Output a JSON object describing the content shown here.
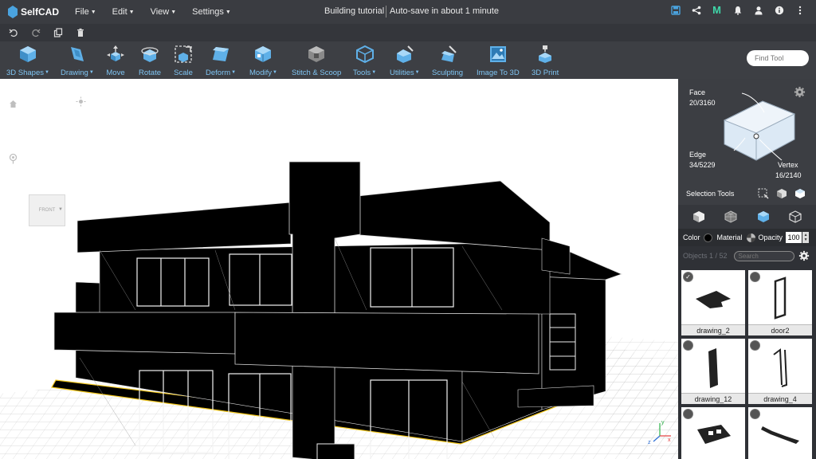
{
  "app": {
    "logo_text": "SelfCAD",
    "document_title": "Building tutorial",
    "autosave_status": "Auto-save in about 1 minute"
  },
  "menu": [
    {
      "label": "File"
    },
    {
      "label": "Edit"
    },
    {
      "label": "View"
    },
    {
      "label": "Settings"
    }
  ],
  "header_icons": [
    "save-icon",
    "share-icon",
    "m-logo-icon",
    "bell-icon",
    "user-icon",
    "info-icon",
    "more-icon"
  ],
  "header_m_letter": "M",
  "subbar_icons": [
    "undo-icon",
    "redo-icon",
    "copy-icon",
    "delete-icon"
  ],
  "toolbar": {
    "tools": [
      {
        "label": "3D Shapes",
        "dropdown": true,
        "icon": "cube-icon"
      },
      {
        "label": "Drawing",
        "dropdown": true,
        "icon": "drawing-icon"
      },
      {
        "label": "Move",
        "dropdown": false,
        "icon": "move-icon"
      },
      {
        "label": "Rotate",
        "dropdown": false,
        "icon": "rotate-icon"
      },
      {
        "label": "Scale",
        "dropdown": false,
        "icon": "scale-icon"
      },
      {
        "label": "Deform",
        "dropdown": true,
        "icon": "deform-icon"
      },
      {
        "label": "Modify",
        "dropdown": true,
        "icon": "modify-icon"
      },
      {
        "label": "Stitch & Scoop",
        "dropdown": false,
        "icon": "stitch-scoop-icon"
      },
      {
        "label": "Tools",
        "dropdown": true,
        "icon": "tools-icon"
      },
      {
        "label": "Utilities",
        "dropdown": true,
        "icon": "utilities-icon"
      },
      {
        "label": "Sculpting",
        "dropdown": false,
        "icon": "sculpting-icon"
      },
      {
        "label": "Image To 3D",
        "dropdown": false,
        "icon": "image-to-3d-icon"
      },
      {
        "label": "3D Print",
        "dropdown": false,
        "icon": "3d-print-icon"
      }
    ],
    "find_placeholder": "Find Tool"
  },
  "viewport": {
    "navcube_label": "FRONT",
    "axis_x": "x",
    "axis_y": "y",
    "axis_z": "z"
  },
  "selection_panel": {
    "face_label": "Face",
    "face_count": "20/3160",
    "edge_label": "Edge",
    "edge_count": "34/5229",
    "vertex_label": "Vertex",
    "vertex_count": "16/2140",
    "tools_label": "Selection Tools"
  },
  "material_row": {
    "color_label": "Color",
    "color_value": "#000000",
    "material_label": "Material",
    "opacity_label": "Opacity",
    "opacity_value": "100"
  },
  "objects": {
    "count_label": "Objects 1 / 52",
    "search_placeholder": "Search",
    "items": [
      {
        "name": "drawing_2",
        "selected": true,
        "check": "✓"
      },
      {
        "name": "door2",
        "selected": false,
        "check": ""
      },
      {
        "name": "drawing_12",
        "selected": false,
        "check": ""
      },
      {
        "name": "drawing_4",
        "selected": false,
        "check": ""
      },
      {
        "name": "",
        "selected": false,
        "check": ""
      },
      {
        "name": "",
        "selected": false,
        "check": ""
      }
    ]
  },
  "colors": {
    "accent": "#4aa3df",
    "toolbar_label": "#7fc4f2",
    "topbar_bg": "#3a3c41",
    "selection_outline": "#f0c419"
  }
}
